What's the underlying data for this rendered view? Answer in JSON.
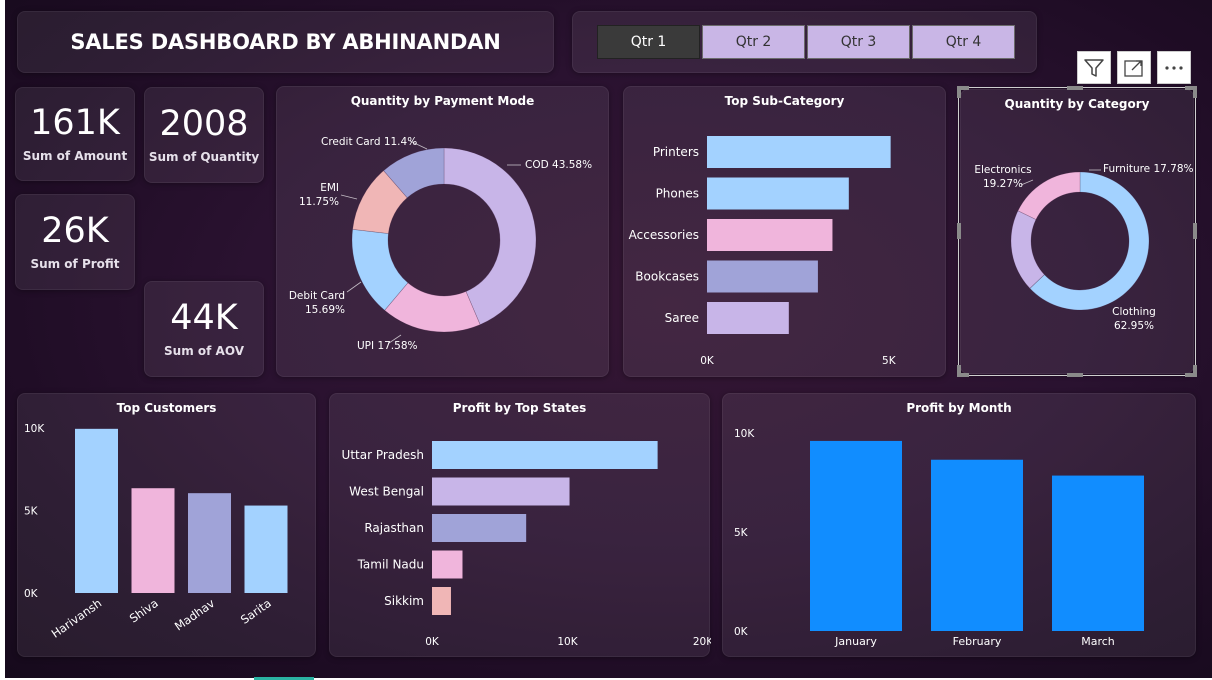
{
  "header": {
    "title": "SALES DASHBOARD BY ABHINANDAN"
  },
  "slicer": {
    "options": [
      "Qtr 1",
      "Qtr 2",
      "Qtr 3",
      "Qtr 4"
    ],
    "selected": "Qtr 1"
  },
  "kpis": {
    "amount": {
      "value": "161K",
      "label": "Sum of Amount"
    },
    "quantity": {
      "value": "2008",
      "label": "Sum of Quantity"
    },
    "profit": {
      "value": "26K",
      "label": "Sum of Profit"
    },
    "aov": {
      "value": "44K",
      "label": "Sum of AOV"
    }
  },
  "visual_header": {
    "icons": [
      "filter-icon",
      "focus-mode-icon",
      "more-options-icon"
    ]
  },
  "colors": {
    "light_blue": "#a3d2ff",
    "lavender": "#c8b5e8",
    "pink": "#f0b5dc",
    "periwinkle": "#a0a3d8",
    "salmon": "#f0b6b6",
    "blue": "#118dff"
  },
  "chart_data": [
    {
      "id": "payment",
      "type": "pie",
      "title": "Quantity by Payment Mode",
      "slices": [
        {
          "label": "COD",
          "value": 43.58,
          "text": "COD 43.58%",
          "color": "#c8b5e8"
        },
        {
          "label": "UPI",
          "value": 17.58,
          "text": "UPI 17.58%",
          "color": "#f0b5dc"
        },
        {
          "label": "Debit Card",
          "value": 15.69,
          "text": "Debit Card|15.69%",
          "color": "#a3d2ff"
        },
        {
          "label": "EMI",
          "value": 11.75,
          "text": "EMI|11.75%",
          "color": "#f0b6b6"
        },
        {
          "label": "Credit Card",
          "value": 11.4,
          "text": "Credit Card 11.4%",
          "color": "#a0a3d8"
        }
      ]
    },
    {
      "id": "subcat",
      "type": "bar",
      "orientation": "horizontal",
      "title": "Top Sub-Category",
      "categories": [
        "Printers",
        "Phones",
        "Accessories",
        "Bookcases",
        "Saree"
      ],
      "values": [
        5050,
        3900,
        3450,
        3050,
        2250
      ],
      "colors": [
        "#a3d2ff",
        "#a3d2ff",
        "#f0b5dc",
        "#a0a3d8",
        "#c8b5e8"
      ],
      "xlim": [
        0,
        5500
      ],
      "xticks": [
        {
          "v": 0,
          "t": "0K"
        },
        {
          "v": 5000,
          "t": "5K"
        }
      ]
    },
    {
      "id": "category",
      "type": "pie",
      "title": "Quantity by Category",
      "slices": [
        {
          "label": "Clothing",
          "value": 62.95,
          "text": "Clothing|62.95%",
          "color": "#a3d2ff"
        },
        {
          "label": "Electronics",
          "value": 19.27,
          "text": "Electronics|19.27%",
          "color": "#c8b5e8"
        },
        {
          "label": "Furniture",
          "value": 17.78,
          "text": "Furniture 17.78%",
          "color": "#f0b5dc"
        }
      ]
    },
    {
      "id": "customers",
      "type": "bar",
      "orientation": "vertical",
      "title": "Top Customers",
      "categories": [
        "Harivansh",
        "Shiva",
        "Madhav",
        "Sarita"
      ],
      "values": [
        9950,
        6350,
        6050,
        5300
      ],
      "colors": [
        "#a3d2ff",
        "#f0b5dc",
        "#a0a3d8",
        "#a3d2ff"
      ],
      "ylim": [
        0,
        10000
      ],
      "yticks": [
        {
          "v": 0,
          "t": "0K"
        },
        {
          "v": 5000,
          "t": "5K"
        },
        {
          "v": 10000,
          "t": "10K"
        }
      ]
    },
    {
      "id": "states",
      "type": "bar",
      "orientation": "horizontal",
      "title": "Profit by Top States",
      "categories": [
        "Uttar Pradesh",
        "West Bengal",
        "Rajasthan",
        "Tamil Nadu",
        "Sikkim"
      ],
      "values": [
        16650,
        10150,
        6950,
        2250,
        1400
      ],
      "colors": [
        "#a3d2ff",
        "#c8b5e8",
        "#a0a3d8",
        "#f0b5dc",
        "#f0b6b6"
      ],
      "xlim": [
        0,
        20000
      ],
      "xticks": [
        {
          "v": 0,
          "t": "0K"
        },
        {
          "v": 10000,
          "t": "10K"
        },
        {
          "v": 20000,
          "t": "20K"
        }
      ]
    },
    {
      "id": "month",
      "type": "bar",
      "orientation": "vertical",
      "title": "Profit by Month",
      "categories": [
        "January",
        "February",
        "March"
      ],
      "values": [
        9600,
        8650,
        7850
      ],
      "colors": [
        "#118dff",
        "#118dff",
        "#118dff"
      ],
      "ylim": [
        0,
        10000
      ],
      "yticks": [
        {
          "v": 0,
          "t": "0K"
        },
        {
          "v": 5000,
          "t": "5K"
        },
        {
          "v": 10000,
          "t": "10K"
        }
      ]
    }
  ]
}
